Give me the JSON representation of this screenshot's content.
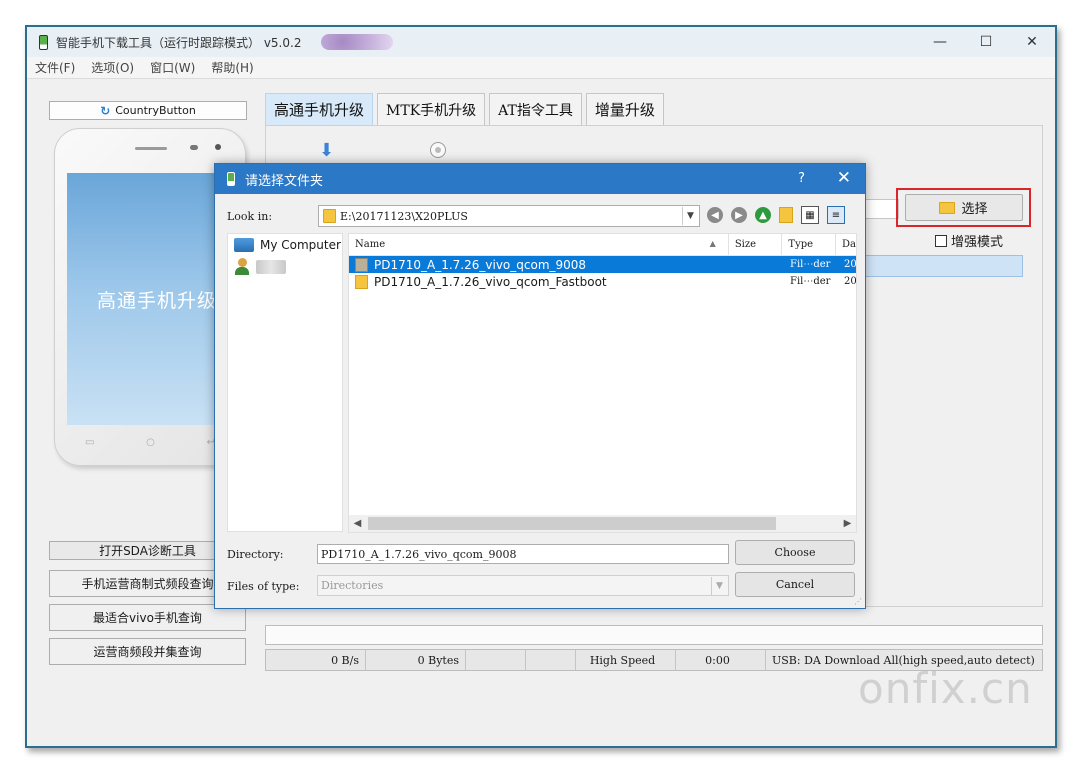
{
  "app": {
    "title": "智能手机下载工具（运行时跟踪模式） v5.0.2",
    "controls": {
      "minimize": "—",
      "maximize": "☐",
      "close": "✕"
    }
  },
  "menu": [
    {
      "label": "文件(F)"
    },
    {
      "label": "选项(O)"
    },
    {
      "label": "窗口(W)"
    },
    {
      "label": "帮助(H)"
    }
  ],
  "left": {
    "country_button": "CountryButton",
    "phone_screen_text": "高通手机升级",
    "buttons": [
      {
        "label": "打开SDA诊断工具"
      },
      {
        "label": "手机运营商制式频段查询"
      },
      {
        "label": "最适合vivo手机查询"
      },
      {
        "label": "运营商频段并集查询"
      }
    ]
  },
  "tabs": [
    {
      "label": "高通手机升级",
      "active": true
    },
    {
      "label": "MTK手机升级",
      "active": false
    },
    {
      "label": "AT指令工具",
      "active": false
    },
    {
      "label": "增量升级",
      "active": false
    }
  ],
  "main": {
    "select_button": "选择",
    "enhance_mode": "增强模式"
  },
  "status": {
    "speed": "0 B/s",
    "bytes": "0 Bytes",
    "mode": "High Speed",
    "time": "0:00",
    "usb": "USB: DA Download All(high speed,auto detect)"
  },
  "watermark": "onfix.cn",
  "dialog": {
    "title": "请选择文件夹",
    "help": "?",
    "close": "✕",
    "look_in_label": "Look in:",
    "look_in_path": "E:\\20171123\\X20PLUS",
    "sidebar": [
      {
        "label": "My Computer",
        "icon": "computer-icon"
      },
      {
        "label": "",
        "icon": "user-icon"
      }
    ],
    "columns": {
      "name": "Name",
      "size": "Size",
      "type": "Type",
      "date": "Da"
    },
    "files": [
      {
        "name": "PD1710_A_1.7.26_vivo_qcom_9008",
        "size": "",
        "type": "Fil⋯der",
        "date": "20",
        "selected": true
      },
      {
        "name": "PD1710_A_1.7.26_vivo_qcom_Fastboot",
        "size": "",
        "type": "Fil⋯der",
        "date": "20",
        "selected": false
      }
    ],
    "directory_label": "Directory:",
    "directory_value": "PD1710_A_1.7.26_vivo_qcom_9008",
    "types_label": "Files of type:",
    "types_value": "Directories",
    "choose": "Choose",
    "cancel": "Cancel"
  }
}
